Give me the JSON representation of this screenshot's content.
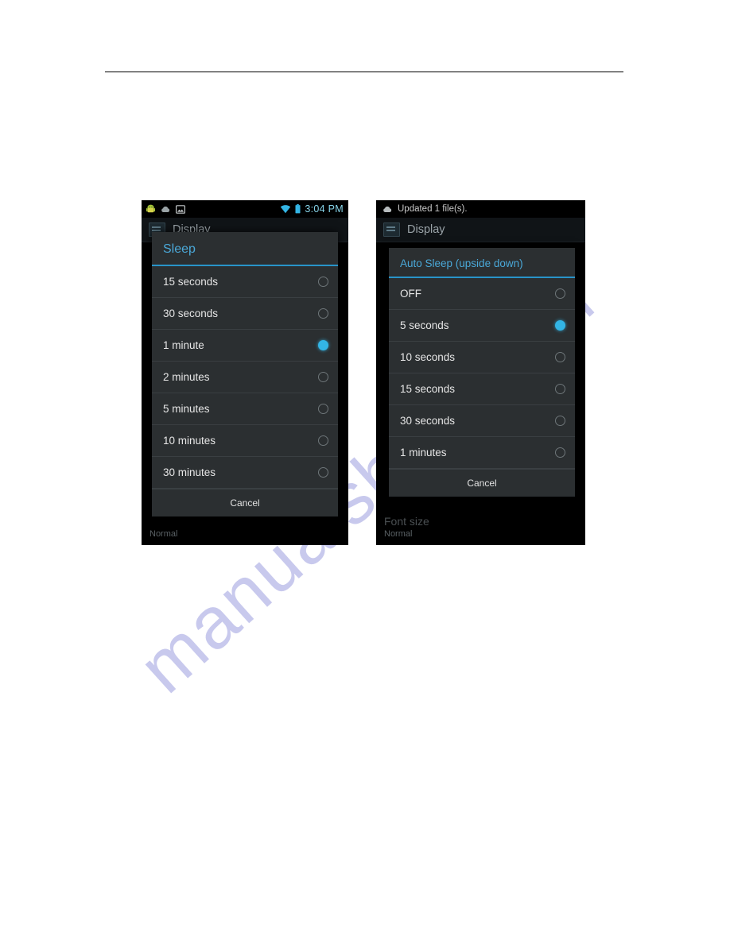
{
  "page": {
    "watermark": "manualshire.com"
  },
  "left_phone": {
    "statusbar": {
      "icons": [
        "android-robot-icon",
        "cloud-upload-icon",
        "gallery-image-icon"
      ],
      "wifi_icon": "wifi-icon",
      "battery_icon": "battery-icon",
      "clock": "3:04 PM",
      "accent_color": "#86d3e8"
    },
    "actionbar": {
      "icon": "display-settings-icon",
      "title": "Display"
    },
    "background": {
      "setting_title": "",
      "setting_sub": "Normal"
    },
    "dialog": {
      "title": "Sleep",
      "accent_color": "#2894c9",
      "items": [
        {
          "label": "15 seconds",
          "selected": false
        },
        {
          "label": "30 seconds",
          "selected": false
        },
        {
          "label": "1 minute",
          "selected": true
        },
        {
          "label": "2 minutes",
          "selected": false
        },
        {
          "label": "5 minutes",
          "selected": false
        },
        {
          "label": "10 minutes",
          "selected": false
        },
        {
          "label": "30 minutes",
          "selected": false
        }
      ],
      "cancel_label": "Cancel"
    }
  },
  "right_phone": {
    "notification": {
      "icon": "cloud-upload-icon",
      "text": "Updated 1 file(s)."
    },
    "actionbar": {
      "icon": "display-settings-icon",
      "title": "Display"
    },
    "background": {
      "setting_title": "Font size",
      "setting_sub": "Normal"
    },
    "dialog": {
      "title": "Auto Sleep (upside down)",
      "accent_color": "#2894c9",
      "items": [
        {
          "label": "OFF",
          "selected": false
        },
        {
          "label": "5 seconds",
          "selected": true
        },
        {
          "label": "10 seconds",
          "selected": false
        },
        {
          "label": "15 seconds",
          "selected": false
        },
        {
          "label": "30 seconds",
          "selected": false
        },
        {
          "label": "1 minutes",
          "selected": false
        }
      ],
      "cancel_label": "Cancel"
    }
  }
}
